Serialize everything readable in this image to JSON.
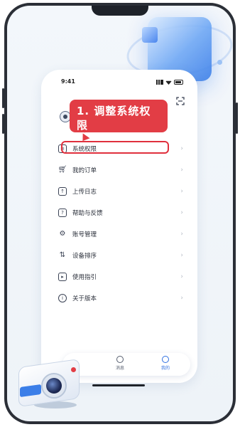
{
  "status_bar": {
    "time": "9:41"
  },
  "callout": {
    "text": "1. 调整系统权限"
  },
  "menu": {
    "items": [
      {
        "label": "系统权限",
        "icon": "sliders-icon"
      },
      {
        "label": "我的订单",
        "icon": "cart-icon"
      },
      {
        "label": "上传日志",
        "icon": "upload-icon"
      },
      {
        "label": "帮助与反馈",
        "icon": "help-icon"
      },
      {
        "label": "账号管理",
        "icon": "user-gear-icon"
      },
      {
        "label": "设备排序",
        "icon": "sort-icon"
      },
      {
        "label": "使用指引",
        "icon": "play-icon"
      },
      {
        "label": "关于版本",
        "icon": "info-icon"
      }
    ]
  },
  "tabbar": {
    "tabs": [
      {
        "label": "消息",
        "icon": "chat-icon",
        "active": false
      },
      {
        "label": "我的",
        "icon": "profile-icon",
        "active": true
      }
    ]
  },
  "colors": {
    "accent": "#2f6fe0",
    "callout": "#e23d45",
    "highlight": "#e0303d"
  }
}
